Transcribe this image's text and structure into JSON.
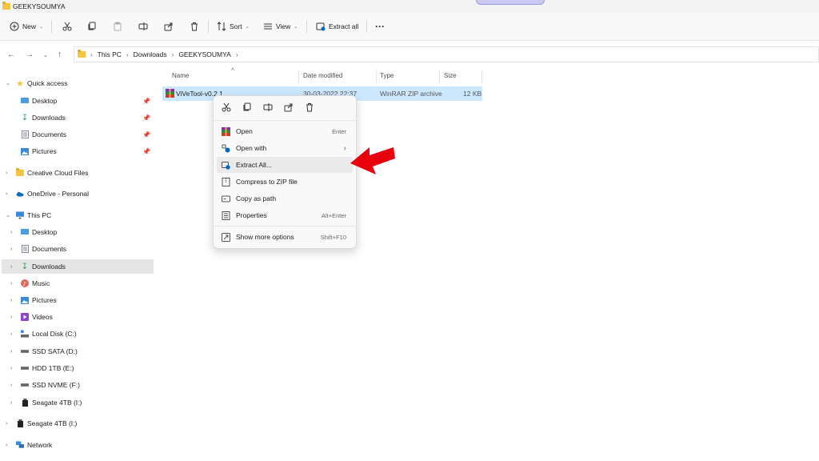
{
  "window": {
    "title": "GEEKYSOUMYA"
  },
  "toolbar": {
    "new_label": "New",
    "sort_label": "Sort",
    "view_label": "View",
    "extract_all_label": "Extract all",
    "more_label": "···"
  },
  "address": {
    "crumbs": [
      "This PC",
      "Downloads",
      "GEEKYSOUMYA"
    ]
  },
  "sidebar": {
    "items": [
      {
        "label": "Quick access"
      },
      {
        "label": "Desktop"
      },
      {
        "label": "Downloads"
      },
      {
        "label": "Documents"
      },
      {
        "label": "Pictures"
      },
      {
        "label": "Creative Cloud Files"
      },
      {
        "label": "OneDrive - Personal"
      },
      {
        "label": "This PC"
      },
      {
        "label": "Desktop"
      },
      {
        "label": "Documents"
      },
      {
        "label": "Downloads"
      },
      {
        "label": "Music"
      },
      {
        "label": "Pictures"
      },
      {
        "label": "Videos"
      },
      {
        "label": "Local Disk (C:)"
      },
      {
        "label": "SSD SATA (D:)"
      },
      {
        "label": "HDD 1TB (E:)"
      },
      {
        "label": "SSD NVME (F:)"
      },
      {
        "label": "Seagate 4TB (I:)"
      },
      {
        "label": "Seagate 4TB (I:)"
      },
      {
        "label": "Network"
      }
    ]
  },
  "columns": {
    "name": "Name",
    "date": "Date modified",
    "type": "Type",
    "size": "Size"
  },
  "file": {
    "name": "ViVeTool-v0.2.1",
    "date": "30-03-2022 22:37",
    "type": "WinRAR ZIP archive",
    "size": "12 KB"
  },
  "context_menu": {
    "items": [
      {
        "label": "Open",
        "key": "Enter"
      },
      {
        "label": "Open with",
        "key": "›"
      },
      {
        "label": "Extract All...",
        "key": ""
      },
      {
        "label": "Compress to ZIP file",
        "key": ""
      },
      {
        "label": "Copy as path",
        "key": ""
      },
      {
        "label": "Properties",
        "key": "Alt+Enter"
      },
      {
        "label": "Show more options",
        "key": "Shift+F10"
      }
    ]
  },
  "colors": {
    "selection": "#cce8ff",
    "accent": "#0067c0",
    "arrow": "#e8000d"
  }
}
